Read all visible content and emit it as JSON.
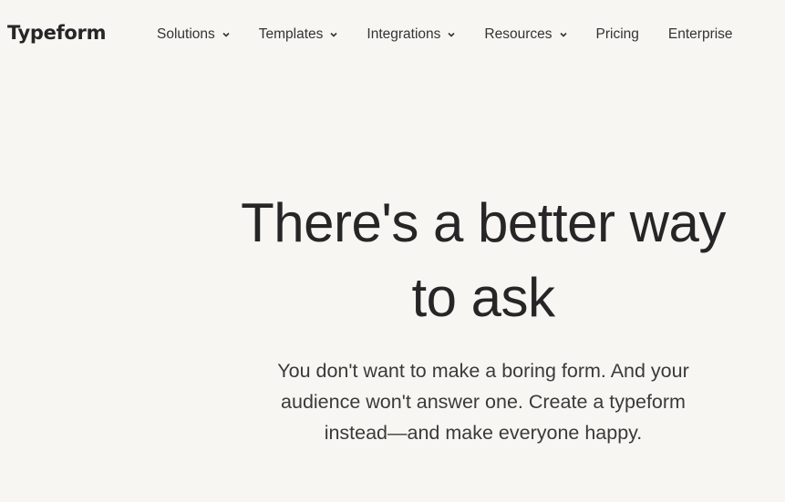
{
  "header": {
    "logo": "Typeform",
    "nav": [
      {
        "label": "Solutions",
        "dropdown": true
      },
      {
        "label": "Templates",
        "dropdown": true
      },
      {
        "label": "Integrations",
        "dropdown": true
      },
      {
        "label": "Resources",
        "dropdown": true
      },
      {
        "label": "Pricing",
        "dropdown": false
      },
      {
        "label": "Enterprise",
        "dropdown": false
      }
    ]
  },
  "hero": {
    "title_line1": "There's a better way",
    "title_line2": "to ask",
    "subtitle": "You don't want to make a boring form. And your audience won't answer one. Create a typeform instead—and make everyone happy."
  },
  "colors": {
    "background": "#f7f6f2",
    "text": "#262627"
  }
}
